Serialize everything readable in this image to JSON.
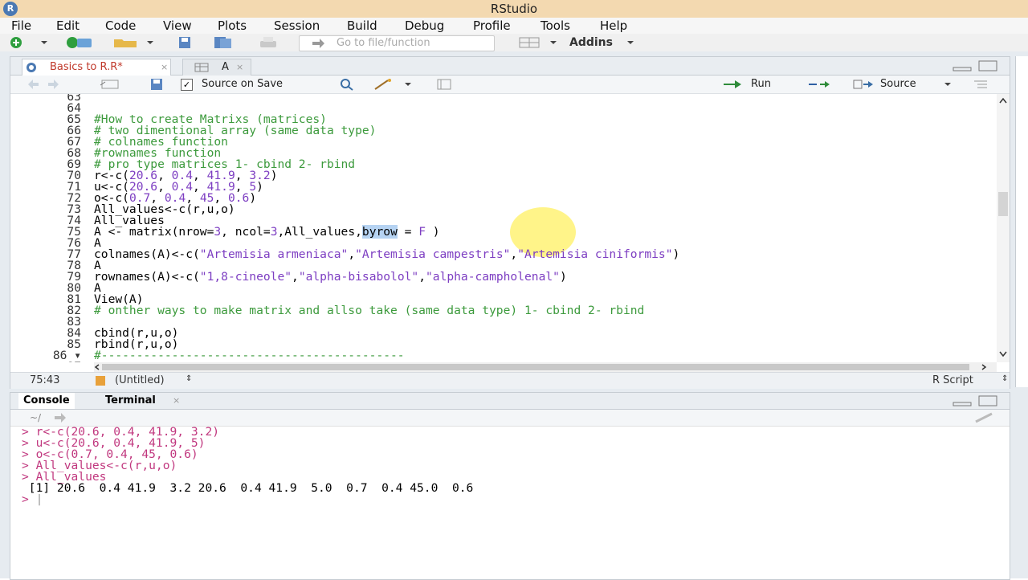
{
  "window": {
    "title": "RStudio",
    "logo_letter": "R"
  },
  "menu": [
    "File",
    "Edit",
    "Code",
    "View",
    "Plots",
    "Session",
    "Build",
    "Debug",
    "Profile",
    "Tools",
    "Help"
  ],
  "toolbar": {
    "goto_placeholder": "Go to file/function",
    "addins_label": "Addins"
  },
  "source": {
    "tabs": [
      {
        "label": "Basics to R.R*",
        "active": true
      },
      {
        "label": "A",
        "active": false
      }
    ],
    "toolbar": {
      "source_on_save": "Source on Save",
      "run_label": "Run",
      "source_label": "Source"
    },
    "status": {
      "cursor": "75:43",
      "context": "(Untitled)",
      "filetype": "R Script"
    }
  },
  "console": {
    "tabs": [
      "Console",
      "Terminal"
    ],
    "path": "~/",
    "prompt": ">"
  },
  "colors": {
    "comment": "#3c9a3c",
    "number": "#7d3ec2",
    "console_input": "#c1387f"
  }
}
